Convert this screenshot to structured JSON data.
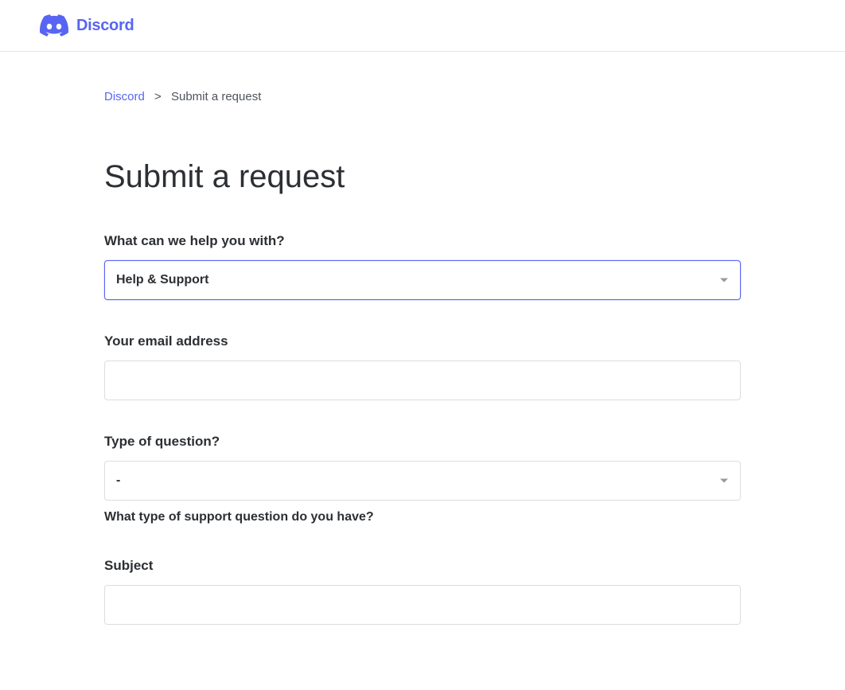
{
  "header": {
    "brand": "Discord"
  },
  "breadcrumb": {
    "home": "Discord",
    "separator": ">",
    "current": "Submit a request"
  },
  "page": {
    "title": "Submit a request"
  },
  "form": {
    "help_with": {
      "label": "What can we help you with?",
      "value": "Help & Support"
    },
    "email": {
      "label": "Your email address",
      "value": ""
    },
    "question_type": {
      "label": "Type of question?",
      "value": "-",
      "help_text": "What type of support question do you have?"
    },
    "subject": {
      "label": "Subject",
      "value": ""
    }
  }
}
